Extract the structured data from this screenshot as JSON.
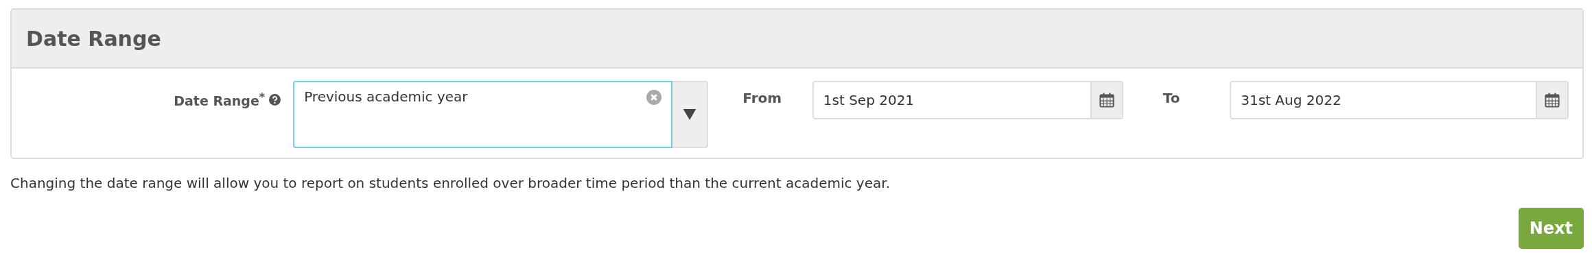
{
  "panel": {
    "title": "Date Range"
  },
  "date_range": {
    "label": "Date Range$^{*}$",
    "value": "Previous academic year"
  },
  "from": {
    "label": "From",
    "value": "1st Sep 2021"
  },
  "to": {
    "label": "To",
    "value": "31st Aug 2022"
  },
  "help_text": "Changing the date range will allow you to report on students enrolled over broader time period than the current academic year.",
  "buttons": [
    "Next"
  ]
}
